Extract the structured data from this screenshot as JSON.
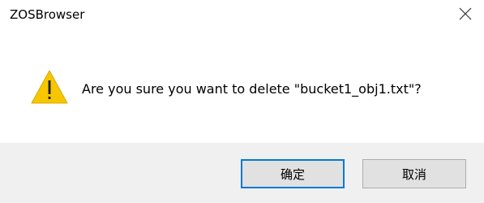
{
  "window": {
    "title": "ZOSBrowser"
  },
  "dialog": {
    "message": "Are you sure you want to delete \"bucket1_obj1.txt\"?",
    "icon": "warning-icon"
  },
  "buttons": {
    "ok_label": "确定",
    "cancel_label": "取消"
  },
  "colors": {
    "warning_fill": "#f6c700",
    "focus_border": "#0078d7",
    "footer_bg": "#f0f0f0",
    "button_bg": "#e1e1e1"
  }
}
